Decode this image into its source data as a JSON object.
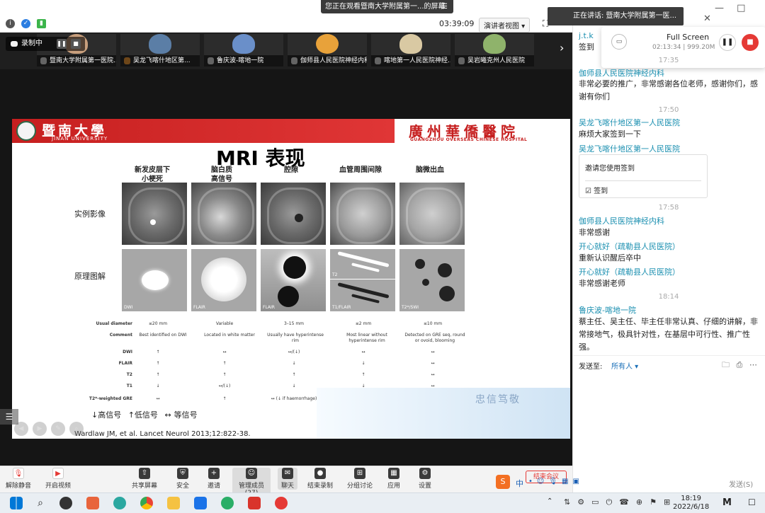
{
  "share_banner": "您正在观看暨南大学附属第一...的屏幕",
  "timer": "03:39:09",
  "presenter_view": "演讲者视图",
  "recording": {
    "label": "录制中"
  },
  "participants": [
    {
      "name": "暨南大学附属第一医院..."
    },
    {
      "name": "吴龙飞喀什地区第..."
    },
    {
      "name": "鲁庆波-喀地一院"
    },
    {
      "name": "伽师县人民医院神经内科"
    },
    {
      "name": "喀地第一人民医院神经..."
    },
    {
      "name": "吴岩曦克州人民医院"
    }
  ],
  "slide": {
    "univ_cn": "暨南大學",
    "univ_en": "JINAN UNIVERSITY",
    "hosp_cn": "廣州華僑醫院",
    "hosp_en": "GUANGZHOU OVERSEAS CHINESE HOSPITAL",
    "title": "MRI 表现",
    "columns": [
      {
        "l1": "新发皮层下",
        "l2": "小梗死"
      },
      {
        "l1": "脑白质",
        "l2": "高信号"
      },
      {
        "l1": "腔隙",
        "l2": ""
      },
      {
        "l1": "血管周围间隙",
        "l2": ""
      },
      {
        "l1": "脑微出血",
        "l2": ""
      }
    ],
    "row_example": "实例影像",
    "row_diagram": "原理图解",
    "diagram_tags": [
      "DWI",
      "FLAIR",
      "FLAIR",
      "T2",
      "T1/FLAIR",
      "T2*/SWI"
    ],
    "table": {
      "rows": [
        {
          "h": "Usual diameter",
          "c": [
            "≤20 mm",
            "Variable",
            "3–15 mm",
            "≤2 mm",
            "≤10 mm"
          ]
        },
        {
          "h": "Comment",
          "c": [
            "Best identified on DWI",
            "Located in white matter",
            "Usually have hyperintense rim",
            "Most linear without hyperintense rim",
            "Detected on GRE seq, round or ovoid, blooming"
          ]
        },
        {
          "h": "DWI",
          "c": [
            "↑",
            "↔",
            "↔/(↓)",
            "↔",
            "↔"
          ]
        },
        {
          "h": "FLAIR",
          "c": [
            "↑",
            "↑",
            "↓",
            "↓",
            "↔"
          ]
        },
        {
          "h": "T2",
          "c": [
            "↑",
            "↑",
            "↑",
            "↑",
            "↔"
          ]
        },
        {
          "h": "T1",
          "c": [
            "↓",
            "↔/(↓)",
            "↓",
            "↓",
            "↔"
          ]
        },
        {
          "h": "T2*-weighted GRE",
          "c": [
            "↔",
            "↑",
            "↔ (↓ if haemorrhage)",
            "↔",
            "↓↓"
          ]
        }
      ]
    },
    "legend": {
      "high": "高信号",
      "low": "低信号",
      "iso": "等信号"
    },
    "citation": "Wardlaw JM, et al. Lancet Neurol 2013;12:822-38.",
    "deco_text": "忠信笃敬"
  },
  "toolbar": {
    "unmute": "解除静音",
    "video": "开启视频",
    "share": "共享屏幕",
    "security": "安全",
    "invite": "邀请",
    "members": "管理成员(27)",
    "chat": "聊天",
    "end_rec": "结束录制",
    "breakout": "分组讨论",
    "apps": "应用",
    "settings": "设置",
    "end_meeting": "结束会议"
  },
  "chat": {
    "speaking": "正在讲话: 暨南大学附属第一医...",
    "full_screen": {
      "title": "Full Screen",
      "time": "02:13:34 | 999.20M"
    },
    "messages": [
      {
        "name": "j.t.k",
        "text": "签到"
      },
      {
        "time": "17:35"
      },
      {
        "name": "伽师县人民医院神经内科",
        "text": "非常必要的推广，非常感谢各位老师，感谢你们，感谢有你们"
      },
      {
        "time": "17:50"
      },
      {
        "name": "吴龙飞喀什地区第一人民医院",
        "text": "麻烦大家签到一下"
      },
      {
        "name": "吴龙飞喀什地区第一人民医院",
        "text": ""
      },
      {
        "time": "17:58"
      },
      {
        "name": "伽师县人民医院神经内科",
        "text": "非常感谢"
      },
      {
        "name": "开心就好（疏勒县人民医院）",
        "text": "重新认识醒后卒中"
      },
      {
        "name": "开心就好（疏勒县人民医院）",
        "text": "非常感谢老师"
      },
      {
        "time": "18:14"
      },
      {
        "name": "鲁庆波-喀地一院",
        "text": "蔡主任、吴主任、毕主任非常认真、仔细的讲解，非常接地气，极具针对性，在基层中可行性、推广性强。"
      }
    ],
    "signin": {
      "prompt": "邀请您使用签到",
      "button": "签到"
    },
    "send_label": "发送至:",
    "send_target": "所有人",
    "send_button": "发送(S)"
  },
  "taskbar": {
    "time": "18:19",
    "date": "2022/6/18",
    "ime": "中"
  }
}
